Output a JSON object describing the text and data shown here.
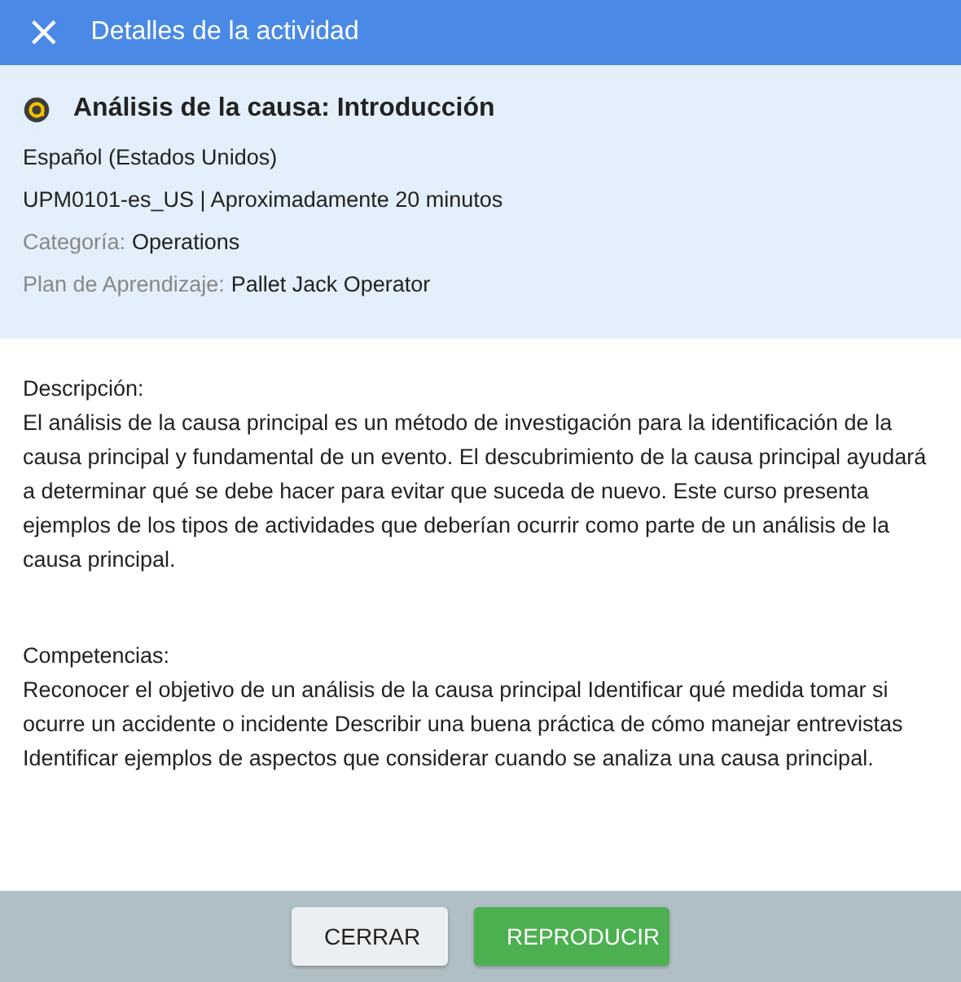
{
  "header": {
    "close": "×",
    "title": "Detalles de la actividad"
  },
  "activity": {
    "title": "Análisis de la causa: Introducción",
    "language": "Español (Estados Unidos)",
    "code_duration": "UPM0101-es_US | Aproximadamente 20 minutos",
    "fields": [
      {
        "label": "Categoría:",
        "value": "Operations"
      },
      {
        "label": "Plan de Aprendizaje:",
        "value": "Pallet Jack Operator"
      }
    ]
  },
  "sections": [
    {
      "heading": "Descripción:",
      "text": "El análisis de la causa principal es un método de investigación para la identificación de la causa principal y fundamental de un evento. El descubrimiento de la causa principal ayudará a determinar qué se debe hacer para evitar que suceda de nuevo. Este curso presenta ejemplos de los tipos de actividades que deberían ocurrir como parte de un análisis de la causa principal."
    },
    {
      "heading": "Competencias:",
      "text": "Reconocer el objetivo de un análisis de la causa principal Identificar qué medida tomar si ocurre un accidente o incidente Describir una buena práctica de cómo manejar entrevistas Identificar ejemplos de aspectos que considerar cuando se analiza una causa principal."
    }
  ],
  "buttons": [
    {
      "label": "CERRAR",
      "kind": "secondary"
    },
    {
      "label": "REPRODUCIR",
      "kind": "primary"
    }
  ]
}
